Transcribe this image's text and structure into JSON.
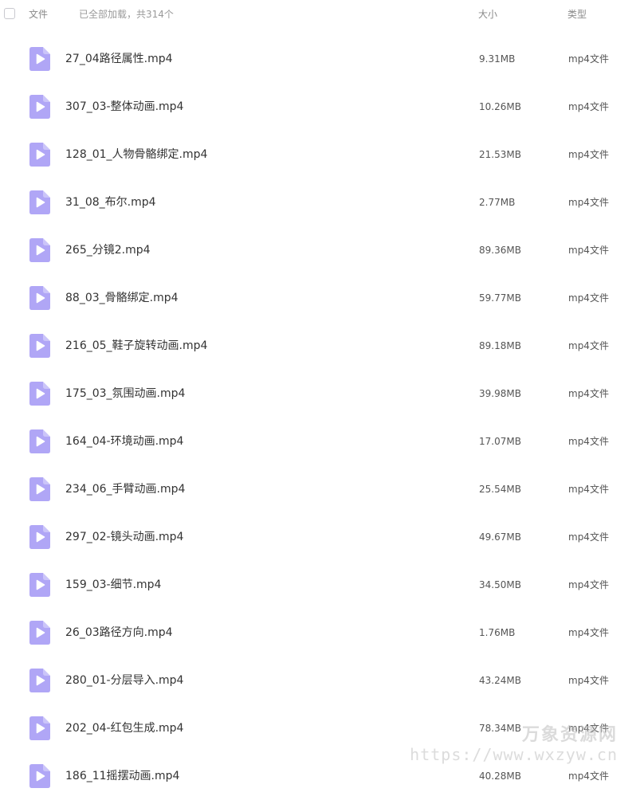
{
  "header": {
    "file_label": "文件",
    "status_text": "已全部加载，共314个",
    "size_label": "大小",
    "type_label": "类型"
  },
  "file_icon": {
    "name": "video-file-icon",
    "color": "#b0a6f6",
    "play_color": "#ffffff"
  },
  "files": [
    {
      "name": "27_04路径属性.mp4",
      "size": "9.31MB",
      "type": "mp4文件"
    },
    {
      "name": "307_03-整体动画.mp4",
      "size": "10.26MB",
      "type": "mp4文件"
    },
    {
      "name": "128_01_人物骨骼绑定.mp4",
      "size": "21.53MB",
      "type": "mp4文件"
    },
    {
      "name": "31_08_布尔.mp4",
      "size": "2.77MB",
      "type": "mp4文件"
    },
    {
      "name": "265_分镜2.mp4",
      "size": "89.36MB",
      "type": "mp4文件"
    },
    {
      "name": "88_03_骨骼绑定.mp4",
      "size": "59.77MB",
      "type": "mp4文件"
    },
    {
      "name": "216_05_鞋子旋转动画.mp4",
      "size": "89.18MB",
      "type": "mp4文件"
    },
    {
      "name": "175_03_氛围动画.mp4",
      "size": "39.98MB",
      "type": "mp4文件"
    },
    {
      "name": "164_04-环境动画.mp4",
      "size": "17.07MB",
      "type": "mp4文件"
    },
    {
      "name": "234_06_手臂动画.mp4",
      "size": "25.54MB",
      "type": "mp4文件"
    },
    {
      "name": "297_02-镜头动画.mp4",
      "size": "49.67MB",
      "type": "mp4文件"
    },
    {
      "name": "159_03-细节.mp4",
      "size": "34.50MB",
      "type": "mp4文件"
    },
    {
      "name": "26_03路径方向.mp4",
      "size": "1.76MB",
      "type": "mp4文件"
    },
    {
      "name": "280_01-分层导入.mp4",
      "size": "43.24MB",
      "type": "mp4文件"
    },
    {
      "name": "202_04-红包生成.mp4",
      "size": "78.34MB",
      "type": "mp4文件"
    },
    {
      "name": "186_11摇摆动画.mp4",
      "size": "40.28MB",
      "type": "mp4文件"
    }
  ],
  "watermark": {
    "title": "万象资源网",
    "url": "https://www.wxzyw.cn"
  }
}
